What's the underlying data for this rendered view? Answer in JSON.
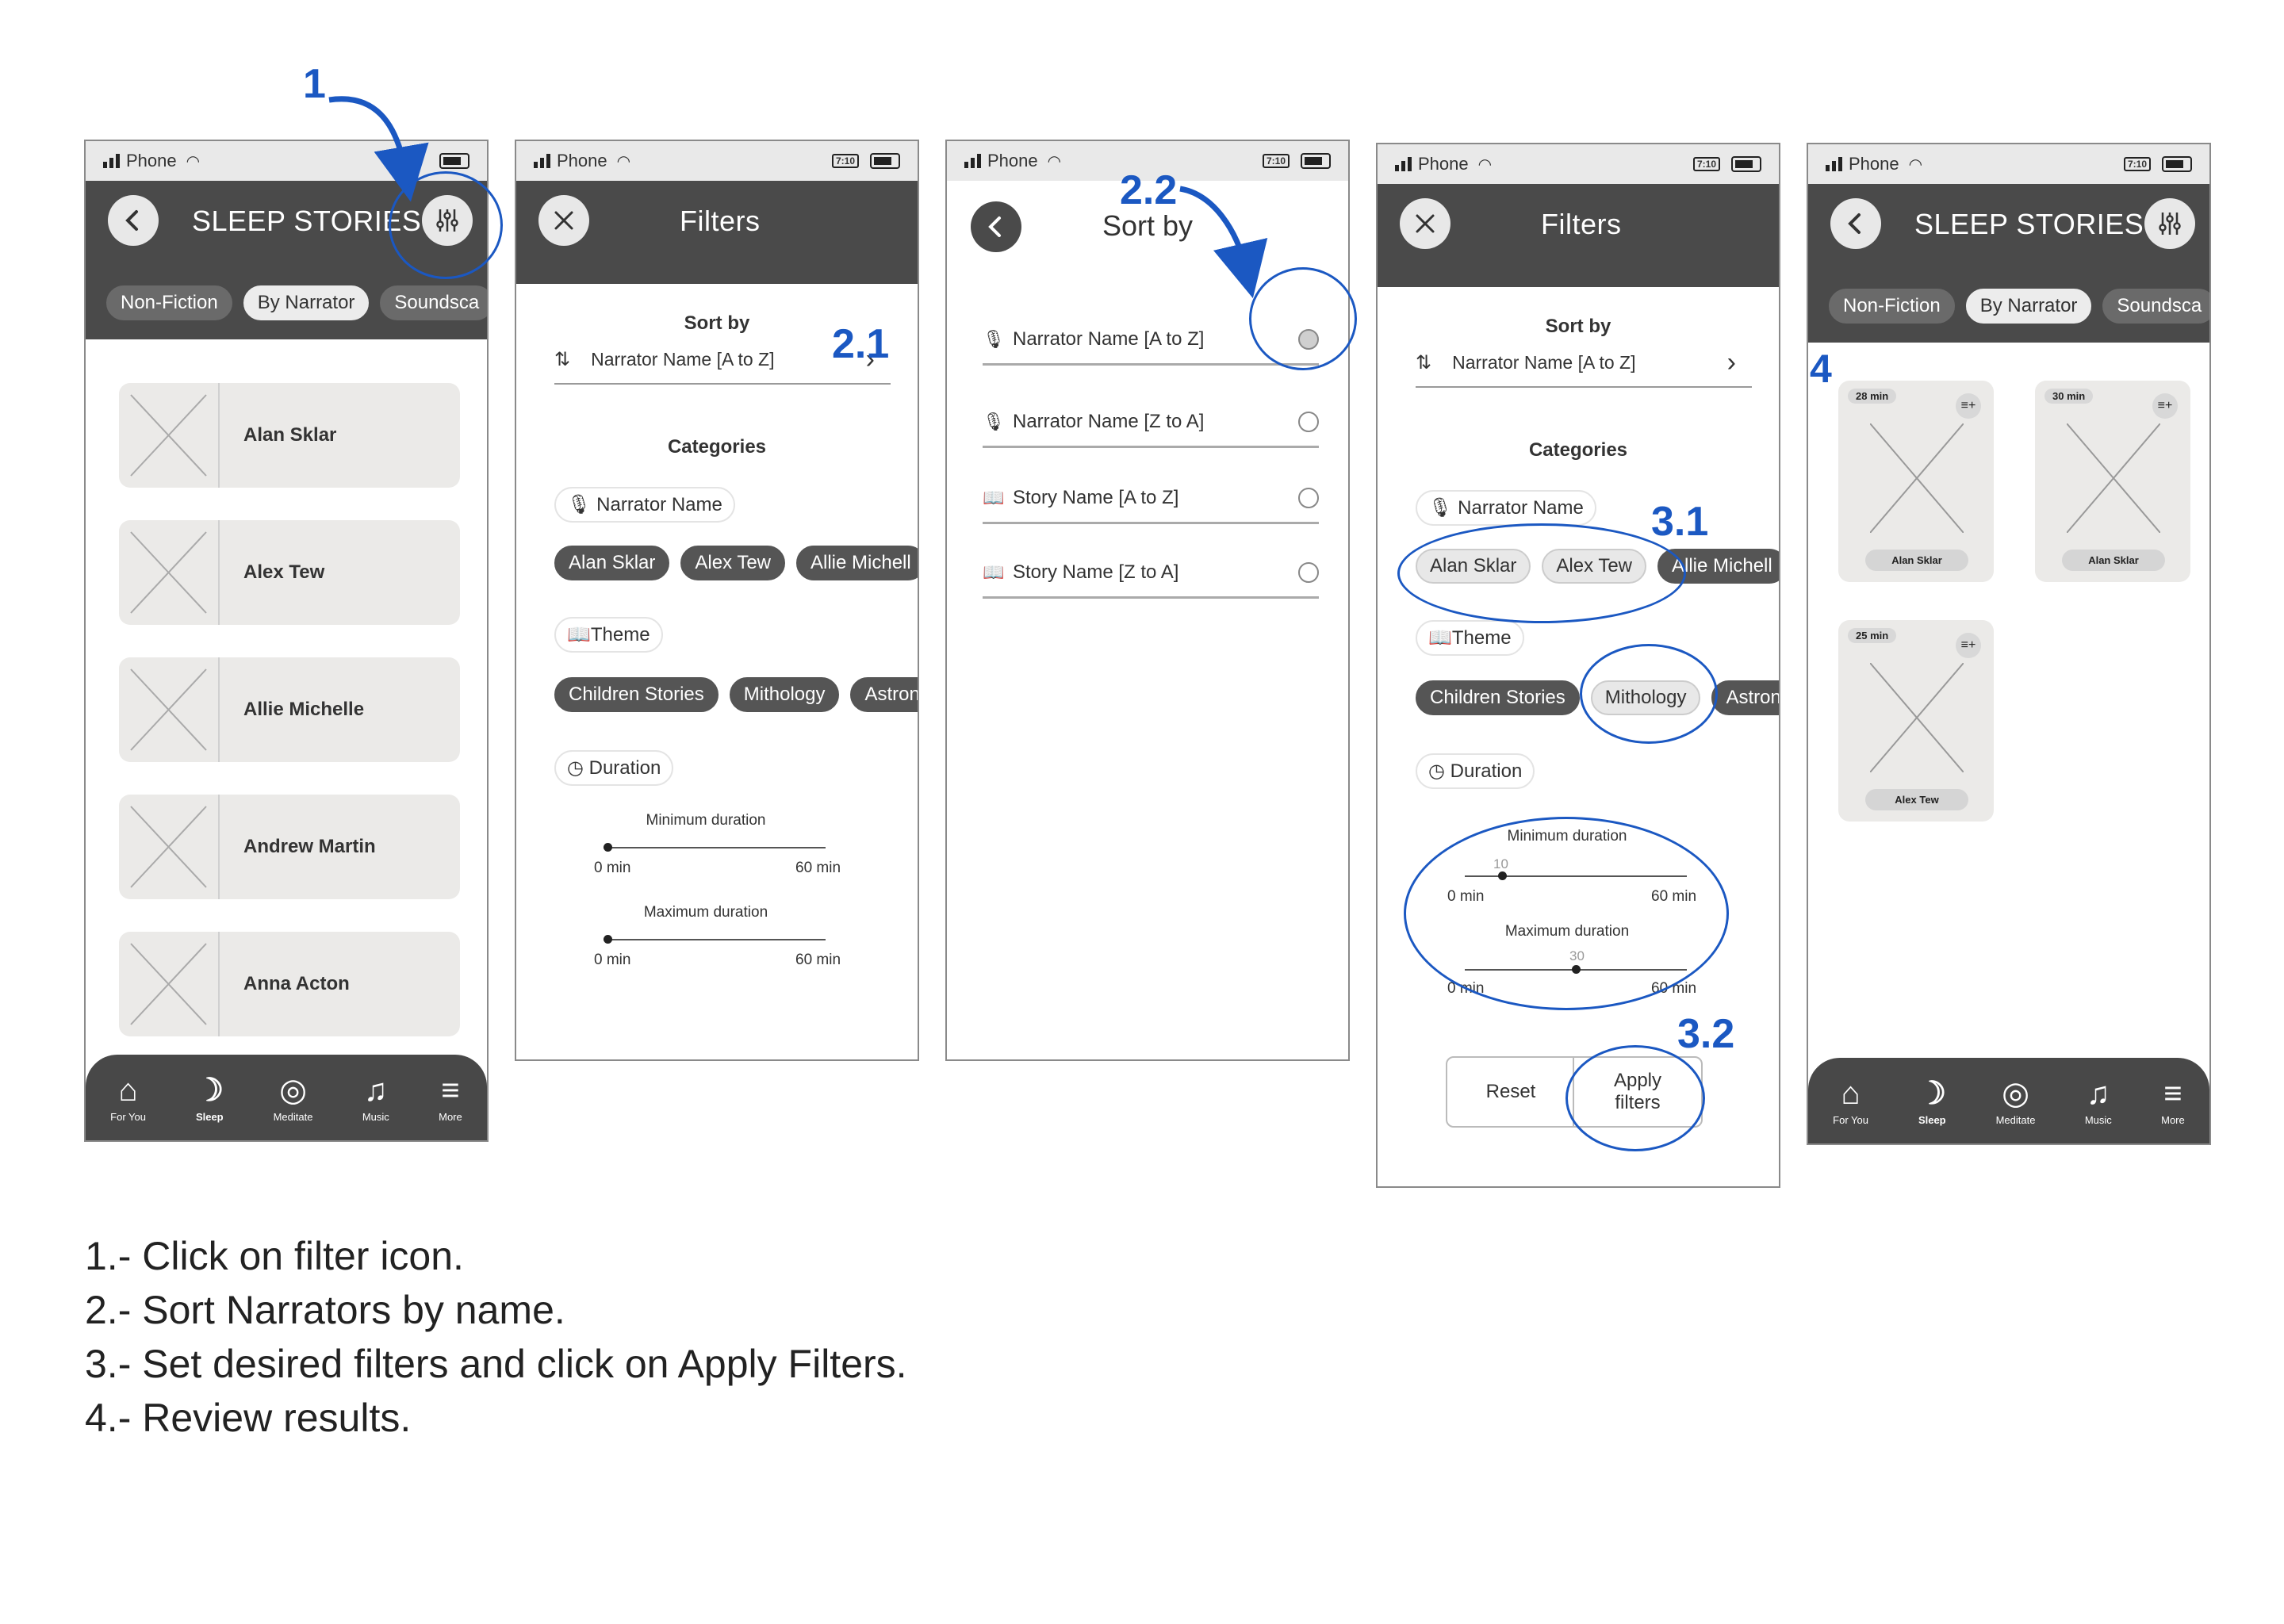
{
  "annotations": {
    "a1": "1",
    "a21": "2.1",
    "a22": "2.2",
    "a31": "3.1",
    "a32": "3.2",
    "a4": "4"
  },
  "status": {
    "carrier": "Phone",
    "badge": "7:10"
  },
  "screen1": {
    "title": "SLEEP STORIES",
    "chips": [
      "Non-Fiction",
      "By Narrator",
      "Soundsca"
    ],
    "narrators": [
      "Alan Sklar",
      "Alex Tew",
      "Allie Michelle",
      "Andrew Martin",
      "Anna Acton"
    ]
  },
  "filters": {
    "title": "Filters",
    "sort_label": "Sort by",
    "sort_value": "Narrator Name [A to Z]",
    "categories_label": "Categories",
    "narrator_label": "Narrator Name",
    "narrator_chips": [
      "Alan Sklar",
      "Alex Tew",
      "Allie Michell"
    ],
    "theme_label": "Theme",
    "theme_chips": [
      "Children Stories",
      "Mithology",
      "Astron"
    ],
    "duration_label": "Duration",
    "min_label": "Minimum duration",
    "max_label": "Maximum duration",
    "zero": "0 min",
    "sixty": "60 min",
    "min_value": "10",
    "max_value": "30",
    "min_fraction": 0.167,
    "max_fraction": 0.5,
    "reset": "Reset",
    "apply": "Apply filters"
  },
  "sortby": {
    "title": "Sort by",
    "options": [
      "Narrator Name [A to Z]",
      "Narrator Name [Z to A]",
      "Story Name [A to Z]",
      "Story Name [Z to A]"
    ]
  },
  "results": {
    "cards": [
      {
        "dur": "28 min",
        "name": "Alan Sklar"
      },
      {
        "dur": "30 min",
        "name": "Alan Sklar"
      },
      {
        "dur": "25 min",
        "name": "Alex Tew"
      }
    ]
  },
  "tabs": [
    "For You",
    "Sleep",
    "Meditate",
    "Music",
    "More"
  ],
  "steps": [
    "1.- Click on filter icon.",
    "2.- Sort Narrators by name.",
    "3.- Set desired filters and click on Apply Filters.",
    "4.- Review results."
  ]
}
